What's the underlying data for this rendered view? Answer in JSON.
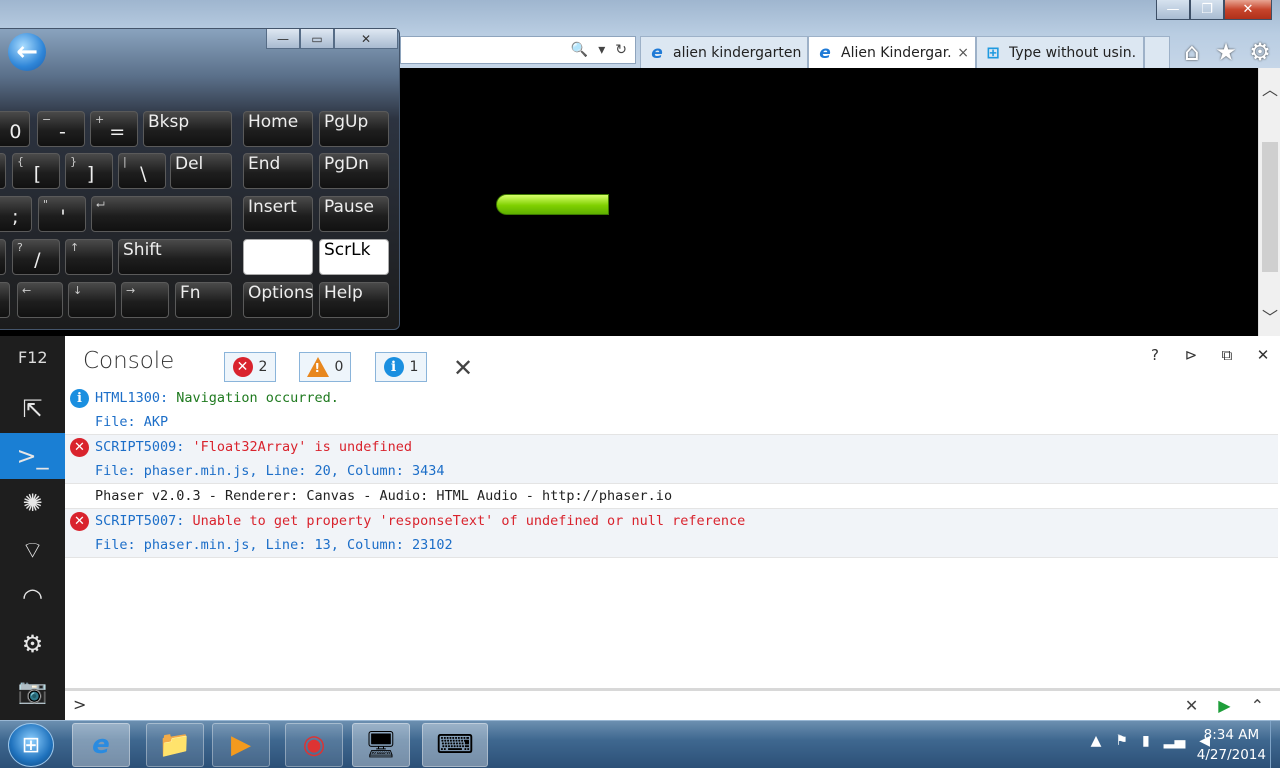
{
  "browser": {
    "caption_buttons": [
      "—",
      "❐",
      "✕"
    ],
    "tabs": [
      {
        "icon": "ie-icon",
        "label": "alien kindergarten ...",
        "active": false
      },
      {
        "icon": "ie-icon",
        "label": "Alien Kindergar...",
        "active": true,
        "close": "×"
      },
      {
        "icon": "windows-icon",
        "label": "Type without usin...",
        "active": false
      }
    ],
    "command_icons": [
      "home-icon",
      "favorites-icon",
      "settings-icon"
    ]
  },
  "game": {
    "health_bar_fraction": 1.0,
    "health_bar_color": "#8ed80a"
  },
  "keyboard": {
    "rows": [
      [
        "0",
        "-",
        "=",
        "Bksp",
        "Home",
        "PgUp"
      ],
      [
        "[",
        "]",
        "\\",
        "Del",
        "End",
        "PgDn"
      ],
      [
        ";",
        "'",
        "Insert",
        "Pause"
      ],
      [
        "/",
        "Shift",
        "",
        "ScrLk"
      ],
      [
        "Fn",
        "Options",
        "Help"
      ]
    ],
    "labels": {
      "zero": "0",
      "minus_top": "−",
      "minus": "-",
      "plus_top": "+",
      "equals": "=",
      "bksp": "Bksp",
      "home": "Home",
      "pgup": "PgUp",
      "lbrace_top": "{",
      "lbracket": "[",
      "rbrace_top": "}",
      "rbracket": "]",
      "pipe_top": "|",
      "backslash": "\\",
      "del": "Del",
      "end": "End",
      "pgdn": "PgDn",
      "semicolon": ";",
      "quote_top": "\"",
      "quote": "'",
      "enter": "⮠",
      "insert": "Insert",
      "pause": "Pause",
      "question_top": "?",
      "slash": "/",
      "up": "↑",
      "shift": "Shift",
      "scrlk": "ScrLk",
      "left": "←",
      "down": "↓",
      "right": "→",
      "fn": "Fn",
      "options": "Options",
      "help": "Help"
    }
  },
  "devtools": {
    "f12_label": "F12",
    "title": "Console",
    "error_count": "2",
    "warning_count": "0",
    "info_count": "1",
    "messages": [
      {
        "type": "info",
        "code": "HTML1300",
        "sep": ": ",
        "text": "Navigation occurred.",
        "file": "File: AKP"
      },
      {
        "type": "error",
        "code": "SCRIPT5009",
        "sep": ": ",
        "text": "'Float32Array' is undefined",
        "file": "File: phaser.min.js, Line: 20, Column: 3434"
      },
      {
        "type": "log",
        "text": "Phaser v2.0.3 - Renderer: Canvas - Audio: HTML Audio - http://phaser.io"
      },
      {
        "type": "error",
        "code": "SCRIPT5007",
        "sep": ": ",
        "text": "Unable to get property 'responseText' of undefined or null reference",
        "file": "File: phaser.min.js, Line: 13, Column: 23102"
      }
    ],
    "prompt": ">"
  },
  "taskbar": {
    "time": "8:34 AM",
    "date": "4/27/2014"
  }
}
